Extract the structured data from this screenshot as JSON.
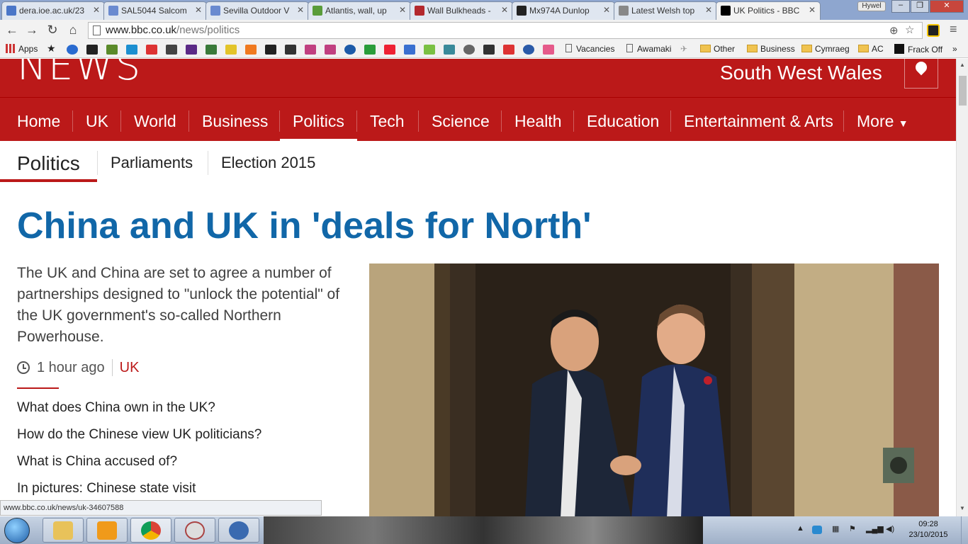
{
  "browser": {
    "tabs": [
      {
        "label": "dera.ioe.ac.uk/23",
        "active": false,
        "icon_color": "#4a76c8"
      },
      {
        "label": "SAL5044 Salcom",
        "active": false,
        "icon_color": "#6a8ad0"
      },
      {
        "label": "Sevilla Outdoor V",
        "active": false,
        "icon_color": "#6a8ad0"
      },
      {
        "label": "Atlantis, wall, up",
        "active": false,
        "icon_color": "#5a9c3a"
      },
      {
        "label": "Wall Bulkheads -",
        "active": false,
        "icon_color": "#b3282d"
      },
      {
        "label": "Mx974A Dunlop",
        "active": false,
        "icon_color": "#222222"
      },
      {
        "label": "Latest Welsh top",
        "active": false,
        "icon_color": "#888888"
      },
      {
        "label": "UK Politics - BBC",
        "active": true,
        "icon_color": "#000000"
      }
    ],
    "profile_name": "Hywel",
    "window_controls": [
      "–",
      "❐",
      "✕"
    ],
    "nav_icons": [
      "back-icon",
      "forward-icon",
      "reload-icon",
      "home-icon"
    ],
    "url_host": "www.bbc.co.uk",
    "url_path": "/news/politics",
    "bookmarks": {
      "apps_label": "Apps",
      "items": [
        "Vacancies",
        "Awamaki"
      ],
      "folders": [
        "Other",
        "Business",
        "Cymraeg",
        "AC"
      ],
      "last": "Frack Off"
    },
    "status_url": "www.bbc.co.uk/news/uk-34607588"
  },
  "page": {
    "logo": "NEWS",
    "region": "South West Wales",
    "nav": [
      "Home",
      "UK",
      "World",
      "Business",
      "Politics",
      "Tech",
      "Science",
      "Health",
      "Education",
      "Entertainment & Arts",
      "More"
    ],
    "nav_active": "Politics",
    "subnav": [
      "Politics",
      "Parliaments",
      "Election 2015"
    ],
    "headline": "China and UK in 'deals for North'",
    "summary": "The UK and China are set to agree a number of partnerships designed to \"unlock the potential\" of the UK government's so-called Northern Powerhouse.",
    "time": "1 hour ago",
    "tag": "UK",
    "related": [
      "What does China own in the UK?",
      "How do the Chinese view UK politicians?",
      "What is China accused of?",
      "In pictures: Chinese state visit"
    ]
  },
  "taskbar": {
    "time": "09:28",
    "date": "23/10/2015"
  },
  "colors": {
    "bbc_red": "#bb1919",
    "headline_blue": "#1167a8"
  }
}
